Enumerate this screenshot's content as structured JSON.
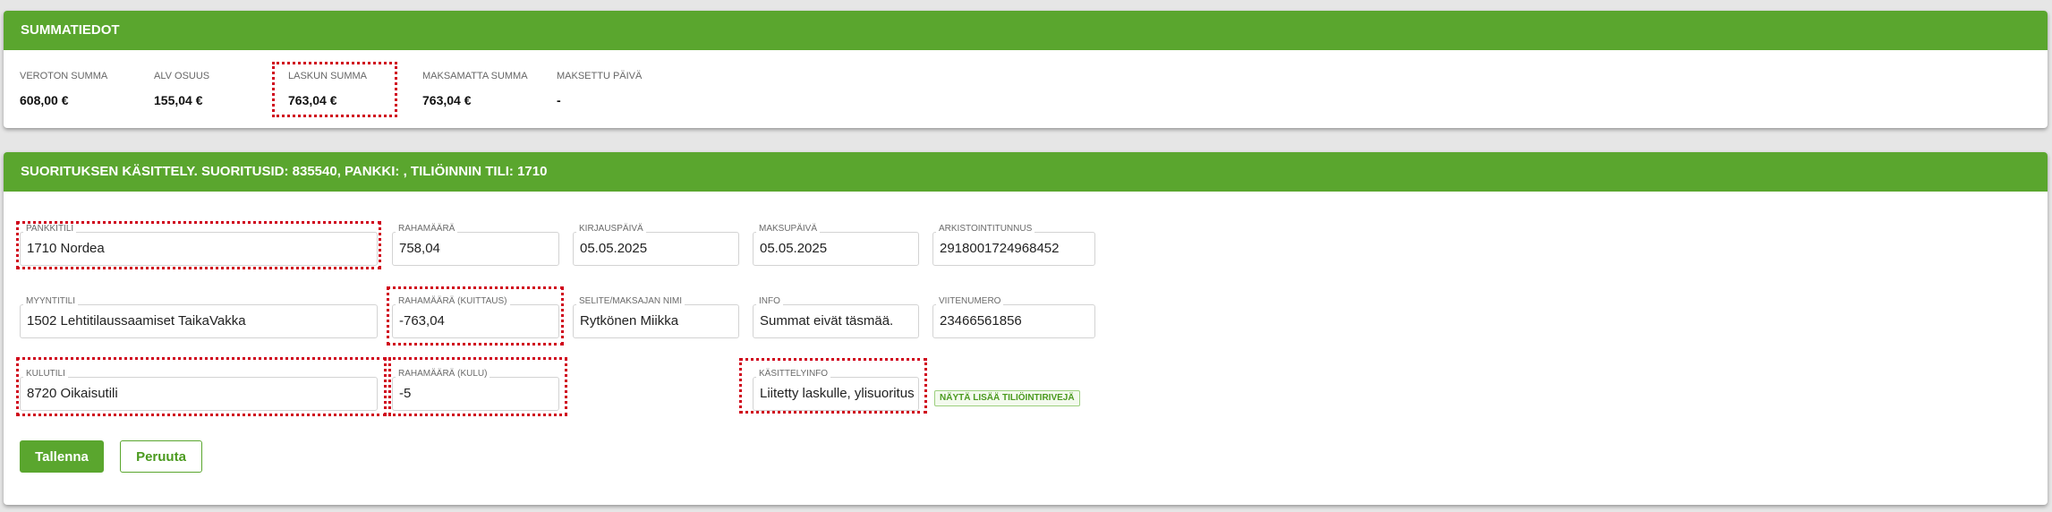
{
  "summary": {
    "title": "SUMMATIEDOT",
    "items": [
      {
        "label": "VEROTON SUMMA",
        "value": "608,00 €"
      },
      {
        "label": "ALV OSUUS",
        "value": "155,04 €"
      },
      {
        "label": "LASKUN SUMMA",
        "value": "763,04 €"
      },
      {
        "label": "MAKSAMATTA SUMMA",
        "value": "763,04 €"
      },
      {
        "label": "MAKSETTU PÄIVÄ",
        "value": "-"
      }
    ]
  },
  "processing": {
    "title_prefix": "SUORITUKSEN KÄSITTELY. SUORITUSID: ",
    "suoritus_id": "835540",
    "title_suffix": ", PANKKI: , TILIÖINNIN TILI: 1710",
    "fields": {
      "pankkitili": {
        "label": "PANKKITILI",
        "value": "1710 Nordea"
      },
      "rahamaara": {
        "label": "RAHAMÄÄRÄ",
        "value": "758,04"
      },
      "kirjauspaiva": {
        "label": "KIRJAUSPÄIVÄ",
        "value": "05.05.2025"
      },
      "maksupaiva": {
        "label": "MAKSUPÄIVÄ",
        "value": "05.05.2025"
      },
      "arkistointitunnus": {
        "label": "ARKISTOINTITUNNUS",
        "value": "2918001724968452"
      },
      "myyntitili": {
        "label": "MYYNTITILI",
        "value": "1502 Lehtitilaussaamiset TaikaVakka"
      },
      "rahamaara_kuittaus": {
        "label": "RAHAMÄÄRÄ (KUITTAUS)",
        "value": "-763,04"
      },
      "selite": {
        "label": "SELITE/MAKSAJAN NIMI",
        "value": "Rytkönen Miikka"
      },
      "info": {
        "label": "INFO",
        "value": "Summat eivät täsmää."
      },
      "viitenumero": {
        "label": "VIITENUMERO",
        "value": "23466561856"
      },
      "kulutili": {
        "label": "KULUTILI",
        "value": "8720 Oikaisutili"
      },
      "rahamaara_kulu": {
        "label": "RAHAMÄÄRÄ (KULU)",
        "value": "-5"
      },
      "kasittelyinfo": {
        "label": "KÄSITTELYINFO",
        "value": "Liitetty laskulle, ylisuoritus"
      }
    },
    "show_more_label": "NÄYTÄ LISÄÄ TILIÖINTIRIVEJÄ",
    "save_label": "Tallenna",
    "cancel_label": "Peruuta"
  },
  "colors": {
    "header_green": "#5aa62e",
    "highlight_red": "#d0021b"
  }
}
